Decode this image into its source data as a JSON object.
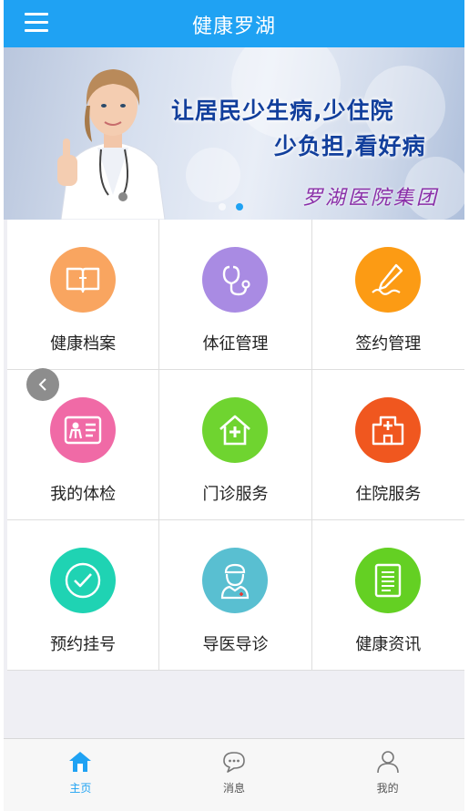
{
  "header": {
    "title": "健康罗湖",
    "menu_icon": "hamburger-menu-icon"
  },
  "banner": {
    "slogan_line1": "让居民少生病,少住院",
    "slogan_line2": "少负担,看好病",
    "hospital_name": "罗湖医院集团",
    "slides": 2,
    "active_slide": 2
  },
  "services": [
    {
      "label": "健康档案",
      "icon": "book-icon",
      "color": "#f9a560"
    },
    {
      "label": "体征管理",
      "icon": "stethoscope-icon",
      "color": "#a98be3"
    },
    {
      "label": "签约管理",
      "icon": "pen-sign-icon",
      "color": "#fc9b14"
    },
    {
      "label": "我的体检",
      "icon": "id-card-icon",
      "color": "#f06aa6"
    },
    {
      "label": "门诊服务",
      "icon": "clinic-house-icon",
      "color": "#6fd430"
    },
    {
      "label": "住院服务",
      "icon": "hospital-building-icon",
      "color": "#f0571f"
    },
    {
      "label": "预约挂号",
      "icon": "check-circle-icon",
      "color": "#1fd3b3"
    },
    {
      "label": "导医导诊",
      "icon": "nurse-icon",
      "color": "#59bfd1"
    },
    {
      "label": "健康资讯",
      "icon": "news-document-icon",
      "color": "#64d023"
    }
  ],
  "tabbar": {
    "items": [
      {
        "label": "主页",
        "icon": "home-icon",
        "active": true
      },
      {
        "label": "消息",
        "icon": "chat-bubble-icon",
        "active": false
      },
      {
        "label": "我的",
        "icon": "user-profile-icon",
        "active": false
      }
    ]
  },
  "colors": {
    "accent": "#1fa2f3",
    "background": "#efeff4"
  }
}
